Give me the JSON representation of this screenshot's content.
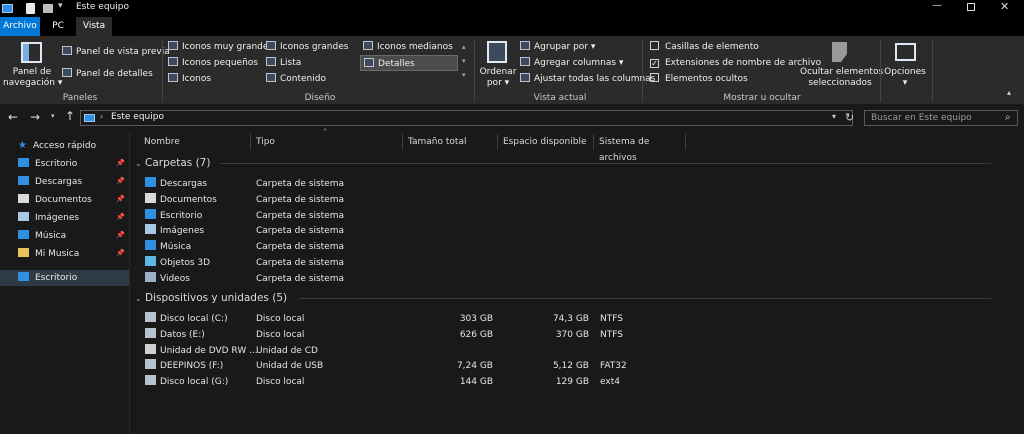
{
  "window": {
    "title": "Este equipo",
    "title_icons": [
      "pc-icon",
      "properties-icon",
      "new-folder-icon",
      "customize-icon"
    ],
    "controls": [
      "minimize-icon",
      "maximize-icon",
      "close-icon"
    ]
  },
  "tabs": [
    {
      "label": "Archivo",
      "active": true
    },
    {
      "label": "PC",
      "active": false
    },
    {
      "label": "Vista",
      "active": false
    }
  ],
  "ribbon": {
    "panes": {
      "navigation_pane": "Panel de\nnavegación ▾",
      "preview_pane": "Panel de vista previa",
      "details_pane": "Panel de detalles",
      "label": "Paneles"
    },
    "layout": {
      "items": [
        "Iconos muy grandes",
        "Iconos grandes",
        "Iconos medianos",
        "Iconos pequeños",
        "Lista",
        "Detalles",
        "Iconos",
        "Contenido"
      ],
      "selected": "Detalles",
      "label": "Diseño"
    },
    "current_view": {
      "sort_by": "Ordenar\npor ▾",
      "group_by": "Agrupar por ▾",
      "add_columns": "Agregar columnas ▾",
      "fit_columns": "Ajustar todas las columnas",
      "label": "Vista actual"
    },
    "show_hide": {
      "item_checkboxes": {
        "label": "Casillas de elemento",
        "checked": false
      },
      "file_extensions": {
        "label": "Extensiones de nombre de archivo",
        "checked": true
      },
      "hidden_items": {
        "label": "Elementos ocultos",
        "checked": false
      },
      "hide_selected": "Ocultar elementos\nseleccionados",
      "label": "Mostrar u ocultar"
    },
    "options": "Opciones\n▾"
  },
  "address": {
    "path": "Este equipo",
    "search_placeholder": "Buscar en Este equipo"
  },
  "nav_pane": {
    "quick_access": "Acceso rápido",
    "items": [
      {
        "label": "Escritorio",
        "icon": "desktop-icon",
        "pinned": true
      },
      {
        "label": "Descargas",
        "icon": "downloads-icon",
        "pinned": true
      },
      {
        "label": "Documentos",
        "icon": "documents-icon",
        "pinned": true
      },
      {
        "label": "Imágenes",
        "icon": "pictures-icon",
        "pinned": true
      },
      {
        "label": "Música",
        "icon": "music-icon",
        "pinned": true
      },
      {
        "label": "Mi Musica",
        "icon": "folder-icon",
        "pinned": true
      }
    ],
    "selected": "Escritorio"
  },
  "columns": [
    "Nombre",
    "Tipo",
    "Tamaño total",
    "Espacio disponible",
    "Sistema de archivos"
  ],
  "groups": {
    "folders": {
      "title": "Carpetas (7)",
      "rows": [
        {
          "name": "Descargas",
          "type": "Carpeta de sistema",
          "icon": "downloads-icon"
        },
        {
          "name": "Documentos",
          "type": "Carpeta de sistema",
          "icon": "documents-icon"
        },
        {
          "name": "Escritorio",
          "type": "Carpeta de sistema",
          "icon": "desktop-icon"
        },
        {
          "name": "Imágenes",
          "type": "Carpeta de sistema",
          "icon": "pictures-icon"
        },
        {
          "name": "Música",
          "type": "Carpeta de sistema",
          "icon": "music-icon"
        },
        {
          "name": "Objetos 3D",
          "type": "Carpeta de sistema",
          "icon": "3d-objects-icon"
        },
        {
          "name": "Videos",
          "type": "Carpeta de sistema",
          "icon": "videos-icon"
        }
      ]
    },
    "drives": {
      "title": "Dispositivos y unidades (5)",
      "rows": [
        {
          "name": "Disco local (C:)",
          "type": "Disco local",
          "total": "303 GB",
          "free": "74,3 GB",
          "fs": "NTFS",
          "icon": "drive-icon"
        },
        {
          "name": "Datos (E:)",
          "type": "Disco local",
          "total": "626 GB",
          "free": "370 GB",
          "fs": "NTFS",
          "icon": "drive-icon"
        },
        {
          "name": "Unidad de DVD RW ...",
          "type": "Unidad de CD",
          "total": "",
          "free": "",
          "fs": "",
          "icon": "dvd-icon"
        },
        {
          "name": "DEEPINOS (F:)",
          "type": "Unidad de USB",
          "total": "7,24 GB",
          "free": "5,12 GB",
          "fs": "FAT32",
          "icon": "usb-drive-icon"
        },
        {
          "name": "Disco local (G:)",
          "type": "Disco local",
          "total": "144 GB",
          "free": "129 GB",
          "fs": "ext4",
          "icon": "drive-icon"
        }
      ]
    }
  },
  "colors": {
    "background": "#191919",
    "ribbon": "#2b2b2b",
    "accent": "#0078d7",
    "selected": "#2e3a46"
  }
}
